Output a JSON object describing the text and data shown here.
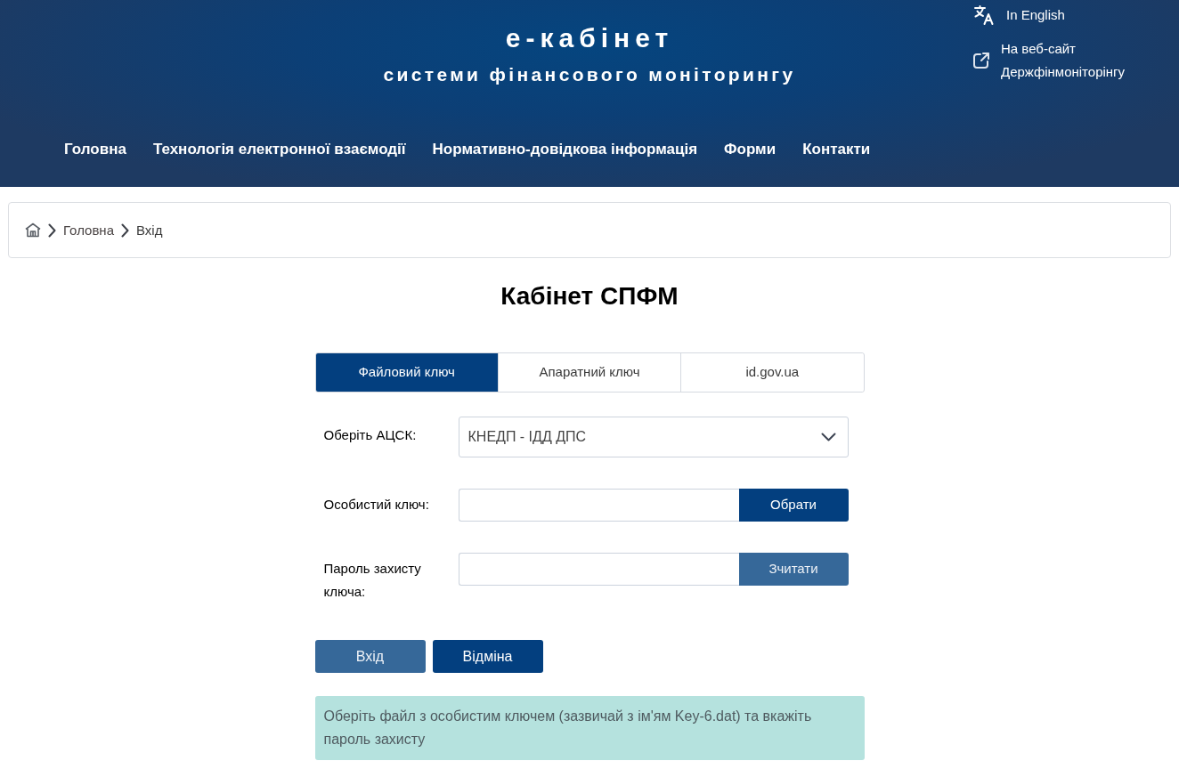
{
  "header": {
    "title": "е-кабінет",
    "subtitle": "системи фінансового моніторингу",
    "links": [
      {
        "kind": "language",
        "label": "In English"
      },
      {
        "kind": "external",
        "label": "На веб-сайт Держфінмоніторінгу"
      }
    ]
  },
  "nav": [
    {
      "label": "Головна"
    },
    {
      "label": "Технологія електронної взаємодії"
    },
    {
      "label": "Нормативно-довідкова інформація"
    },
    {
      "label": "Форми"
    },
    {
      "label": "Контакти"
    }
  ],
  "breadcrumb": [
    "Головна",
    "Вхід"
  ],
  "page_title": "Кабінет СПФМ",
  "tabs": [
    {
      "label": "Файловий ключ",
      "selected": true
    },
    {
      "label": "Апаратний ключ",
      "selected": false
    },
    {
      "label": "id.gov.ua",
      "selected": false
    }
  ],
  "fields": [
    {
      "kind": "select",
      "label": "Оберіть АЦСК:",
      "value": "КНЕДП - ІДД ДПС"
    },
    {
      "kind": "file",
      "label": "Особистий ключ:",
      "button": {
        "label": "Обрати",
        "disabled": false
      }
    },
    {
      "kind": "password",
      "label": "Пароль захисту ключа:",
      "button": {
        "label": "Зчитати",
        "disabled": true
      }
    }
  ],
  "actions": [
    {
      "label": "Вхід",
      "disabled": true
    },
    {
      "label": "Відміна",
      "disabled": false
    }
  ],
  "hint": "Оберіть файл з особистим ключем (зазвичай з ім'ям Key-6.dat) та вкажіть пароль захисту"
}
